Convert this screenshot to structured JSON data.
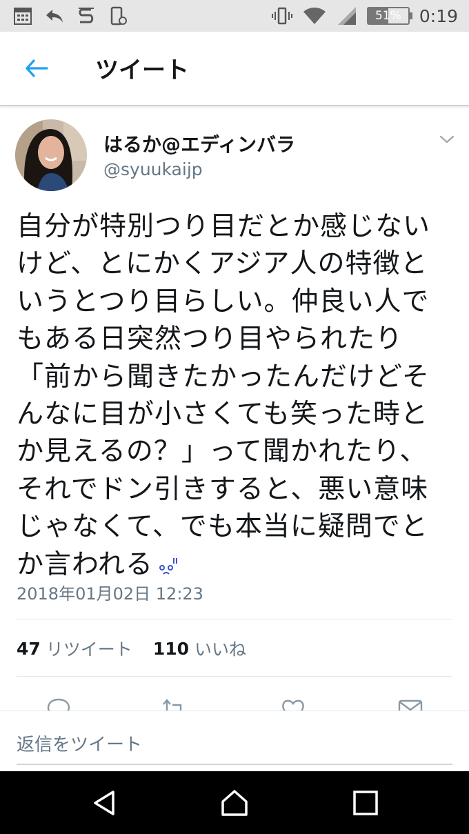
{
  "status_bar": {
    "left_icons": [
      "calendar-icon",
      "reply-icon",
      "s-app-icon",
      "phone-settings-icon"
    ],
    "right_icons": [
      "vibrate-icon",
      "wifi-icon",
      "signal-icon"
    ],
    "battery_percent": "51%",
    "battery_level": 0.51,
    "time": "0:19"
  },
  "header": {
    "title": "ツイート",
    "back_icon": "back-arrow-icon"
  },
  "tweet": {
    "author_name": "はるか@エディンバラ",
    "author_handle": "@syuukaijp",
    "text_lines": [
      "自分が特別つり目だとか感じない",
      "けど、とにかくアジア人の特徴と",
      "いうとつり目らしい。仲良い人で",
      "もある日突然つり目やられたり",
      "「前から聞きたかったんだけどそ",
      "んなに目が小さくても笑った時と",
      "か見えるの？」って聞かれたり、",
      "それでドン引きすると、悪い意味",
      "じゃなくて、でも本当に疑問でと",
      "か言われる"
    ],
    "emoji": "sweat-face-icon",
    "timestamp": "2018年01月02日 12:23",
    "retweet_count": "47",
    "retweet_label": "リツイート",
    "like_count": "110",
    "like_label": "いいね"
  },
  "actions": [
    "reply-icon",
    "retweet-icon",
    "like-icon",
    "dm-icon"
  ],
  "reply_placeholder": "返信をツイート",
  "colors": {
    "accent": "#1da1f2",
    "secondary_text": "#657786",
    "nav_bg": "#000000"
  }
}
